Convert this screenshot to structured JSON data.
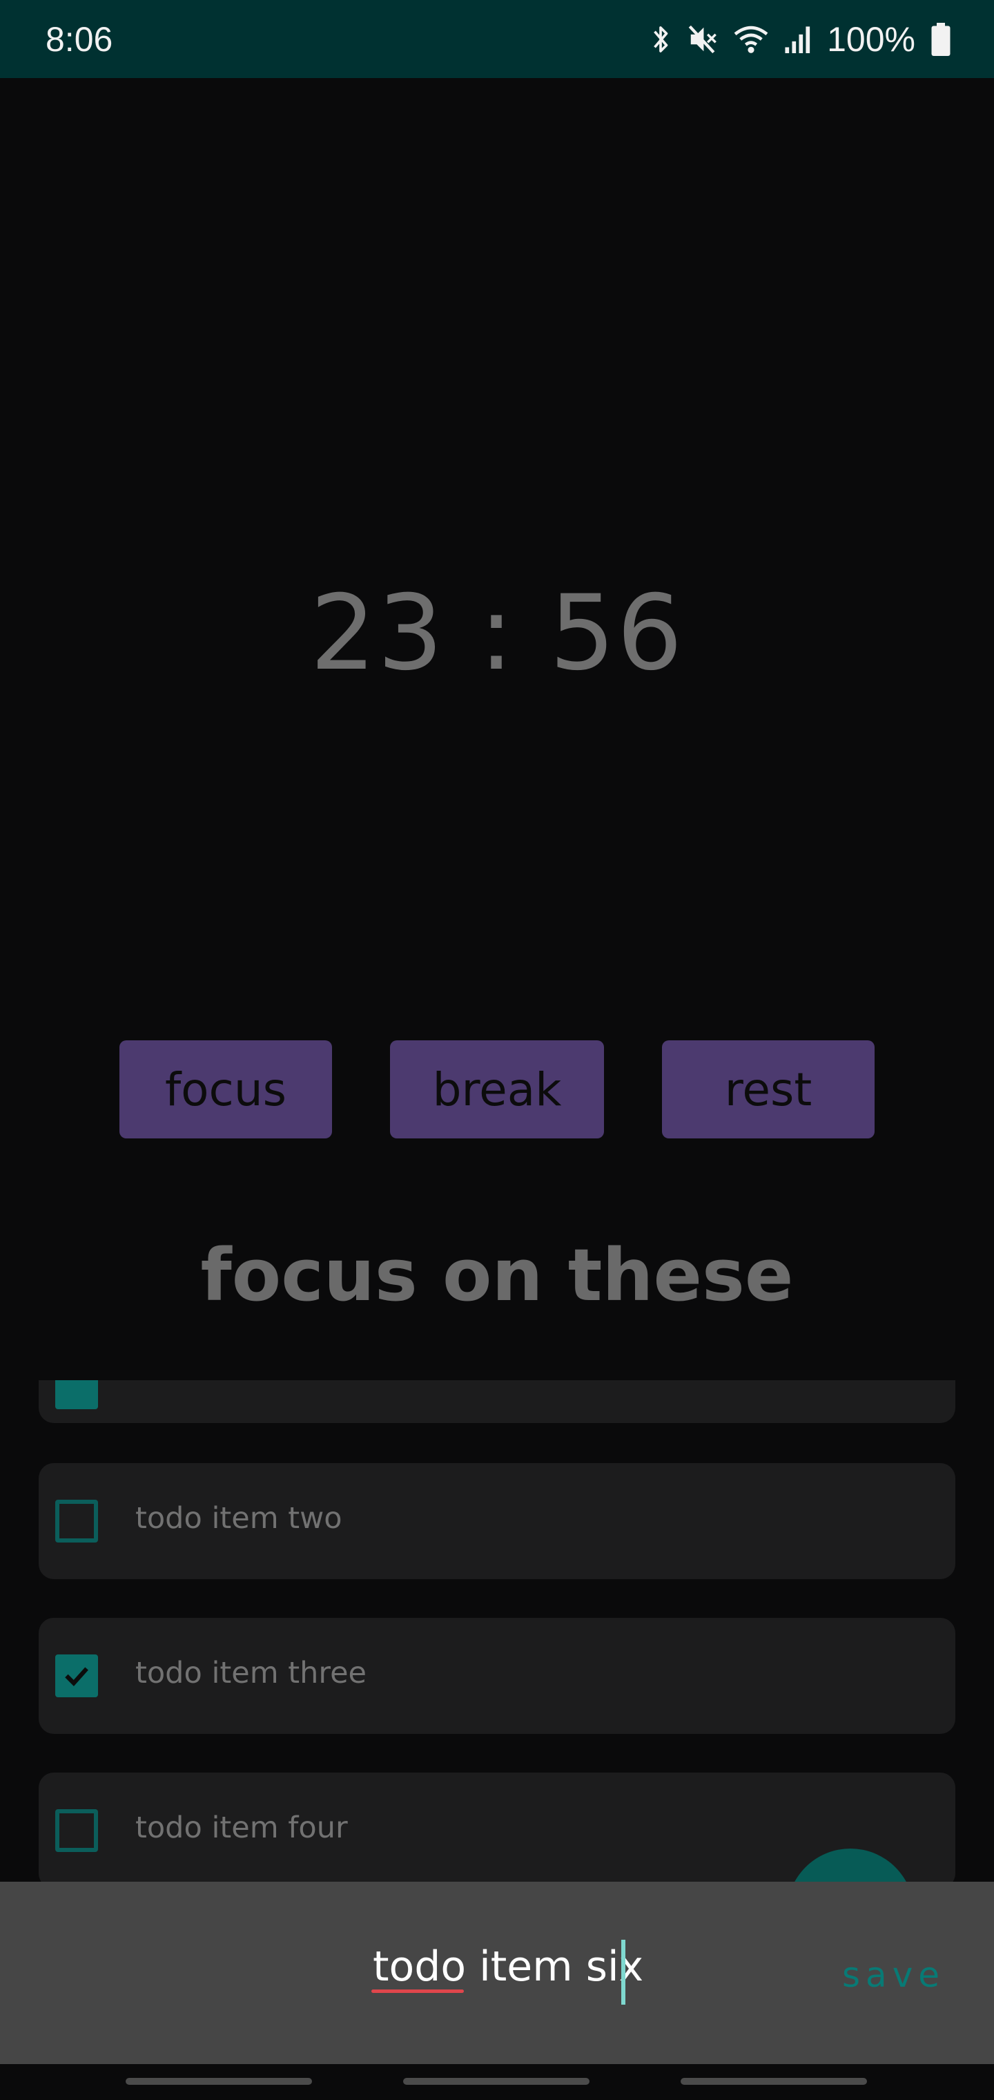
{
  "status_bar": {
    "time": "8:06",
    "battery_text": "100%",
    "icons": [
      "bluetooth-icon",
      "mute-icon",
      "wifi-icon",
      "signal-icon",
      "battery-icon"
    ]
  },
  "timer": {
    "display": "23 : 56"
  },
  "modes": [
    {
      "label": "focus"
    },
    {
      "label": "break"
    },
    {
      "label": "rest"
    }
  ],
  "section": {
    "title": "focus on these"
  },
  "todos": [
    {
      "label": "",
      "checked": true
    },
    {
      "label": "todo item two",
      "checked": false
    },
    {
      "label": "todo item three",
      "checked": true
    },
    {
      "label": "todo item four",
      "checked": false
    }
  ],
  "input": {
    "value": "todo item six",
    "save_label": "save"
  },
  "colors": {
    "status_bar": "#003131",
    "background": "#0a0a0b",
    "mode_button": "#4c3a6f",
    "accent": "#0b6e69",
    "input_panel": "#464646"
  }
}
